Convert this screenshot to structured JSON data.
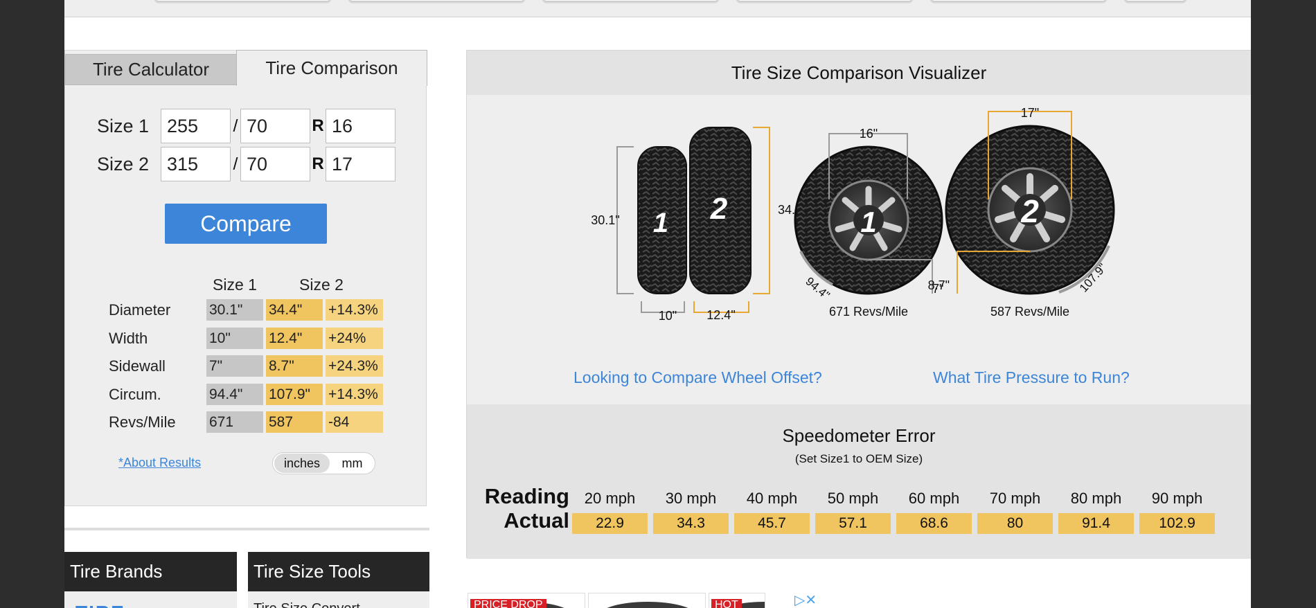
{
  "tabs": {
    "calculator": "Tire Calculator",
    "comparison": "Tire Comparison"
  },
  "form": {
    "size1": {
      "label": "Size 1",
      "width": "255",
      "aspect": "70",
      "r": "R",
      "rim": "16"
    },
    "size2": {
      "label": "Size 2",
      "width": "315",
      "aspect": "70",
      "r": "R",
      "rim": "17"
    },
    "slash": "/",
    "compare_label": "Compare"
  },
  "results": {
    "headers": {
      "size1": "Size 1",
      "size2": "Size 2"
    },
    "rows": [
      {
        "label": "Diameter",
        "s1": "30.1\"",
        "s2": "34.4\"",
        "diff": "+14.3%"
      },
      {
        "label": "Width",
        "s1": "10\"",
        "s2": "12.4\"",
        "diff": "+24%"
      },
      {
        "label": "Sidewall",
        "s1": "7\"",
        "s2": "8.7\"",
        "diff": "+24.3%"
      },
      {
        "label": "Circum.",
        "s1": "94.4\"",
        "s2": "107.9\"",
        "diff": "+14.3%"
      },
      {
        "label": "Revs/Mile",
        "s1": "671",
        "s2": "587",
        "diff": "-84"
      }
    ],
    "about_link": "*About Results",
    "units": {
      "inches": "inches",
      "mm": "mm",
      "selected": "inches"
    }
  },
  "bottom_nav": {
    "brands": "Tire Brands",
    "tools": "Tire Size Tools",
    "tools_peek": "Tire Size Convert"
  },
  "visualizer": {
    "title": "Tire Size Comparison Visualizer",
    "side": {
      "tire1_number": "1",
      "tire2_number": "2",
      "height1": "30.1\"",
      "height2": "34.4\"",
      "width1": "10\"",
      "width2": "12.4\""
    },
    "front": {
      "rim1": "16\"",
      "rim2": "17\"",
      "circ1": "94.4\"",
      "circ2": "107.9\"",
      "sidewall1": "7\"",
      "sidewall2": "8.7\"",
      "revs1": "671 Revs/Mile",
      "revs2": "587 Revs/Mile"
    }
  },
  "links": {
    "offset": "Looking to Compare Wheel Offset?",
    "pressure": "What Tire Pressure to Run?"
  },
  "speedometer": {
    "title": "Speedometer Error",
    "subtitle": "(Set Size1 to OEM Size)",
    "reading_label": "Reading",
    "actual_label": "Actual",
    "readings": [
      "20 mph",
      "30 mph",
      "40 mph",
      "50 mph",
      "60 mph",
      "70 mph",
      "80 mph",
      "90 mph"
    ],
    "actuals": [
      "22.9",
      "34.3",
      "45.7",
      "57.1",
      "68.6",
      "80",
      "91.4",
      "102.9"
    ]
  },
  "ads": {
    "badge1": "PRICE DROP",
    "badge2": "HOT"
  },
  "colors": {
    "accent": "#3c85d8",
    "highlight": "#f0c45f",
    "highlight_light": "#f6d37f",
    "neutral_cell": "#c6c6c6"
  }
}
